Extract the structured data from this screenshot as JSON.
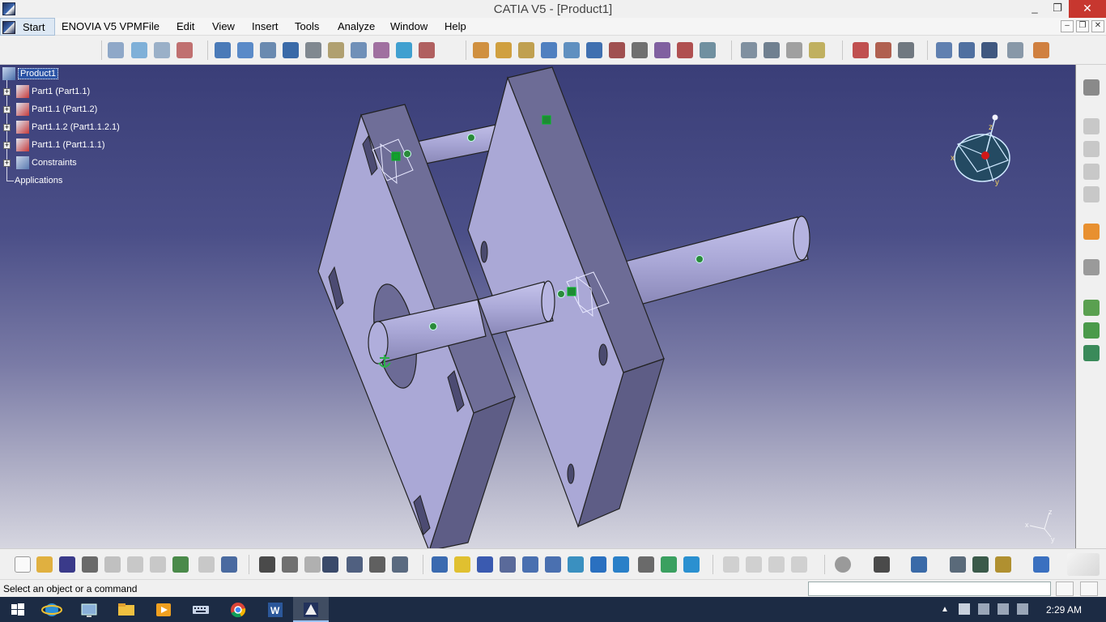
{
  "window": {
    "title": "CATIA V5 - [Product1]",
    "minimize": "_",
    "restore": "❐",
    "close": "✕"
  },
  "menu": {
    "start": "Start",
    "items": [
      "ENOVIA V5 VPM",
      "File",
      "Edit",
      "View",
      "Insert",
      "Tools",
      "Analyze",
      "Window",
      "Help"
    ]
  },
  "tree": {
    "root": "Product1",
    "items": [
      {
        "label": "Part1 (Part1.1)",
        "icon": "part-icon"
      },
      {
        "label": "Part1.1 (Part1.2)",
        "icon": "part-icon"
      },
      {
        "label": "Part1.1.2 (Part1.1.2.1)",
        "icon": "part-icon"
      },
      {
        "label": "Part1.1 (Part1.1.1)",
        "icon": "part-icon"
      },
      {
        "label": "Constraints",
        "icon": "constraints-icon"
      }
    ],
    "applications": "Applications"
  },
  "compass": {
    "x": "x",
    "y": "y",
    "z": "z"
  },
  "axis_triad": {
    "x": "x",
    "y": "y",
    "z": "z"
  },
  "status": {
    "message": "Select an object or a command",
    "input_value": ""
  },
  "taskbar": {
    "apps": [
      "windows-start-icon",
      "internet-explorer-icon",
      "remote-desktop-icon",
      "file-explorer-icon",
      "media-player-icon",
      "keyboard-icon",
      "chrome-icon",
      "word-icon",
      "catia-icon"
    ],
    "time": "2:29 AM"
  },
  "colors": {
    "viewport_top": "#3a3e78",
    "viewport_bottom": "#d6d6e0",
    "part_face": "#a8a6d4",
    "part_side": "#6f6e94",
    "taskbar": "#1c2b44"
  }
}
